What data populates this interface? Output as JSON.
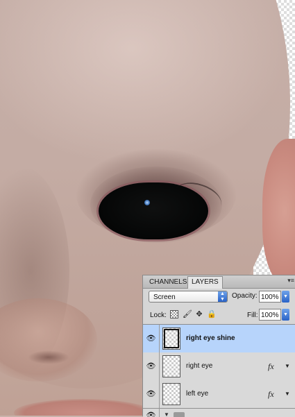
{
  "panel": {
    "tabs": [
      {
        "label": "CHANNELS",
        "active": false
      },
      {
        "label": "LAYERS",
        "active": true
      }
    ],
    "menu_icon": "panel-menu-icon",
    "blend_mode": "Screen",
    "opacity_label": "Opacity:",
    "opacity_value": "100%",
    "lock_label": "Lock:",
    "fill_label": "Fill:",
    "fill_value": "100%",
    "layers": [
      {
        "name": "right eye shine",
        "selected": true,
        "visible": true,
        "fx": ""
      },
      {
        "name": "right eye",
        "selected": false,
        "visible": true,
        "fx": "fx"
      },
      {
        "name": "left eye",
        "selected": false,
        "visible": true,
        "fx": "fx"
      }
    ],
    "group": {
      "name": "",
      "expanded": true
    }
  },
  "colors": {
    "selected_row": "#b7d4fb",
    "accent_blue": "#2a63c7",
    "panel_bg": "#d6d6d6"
  }
}
